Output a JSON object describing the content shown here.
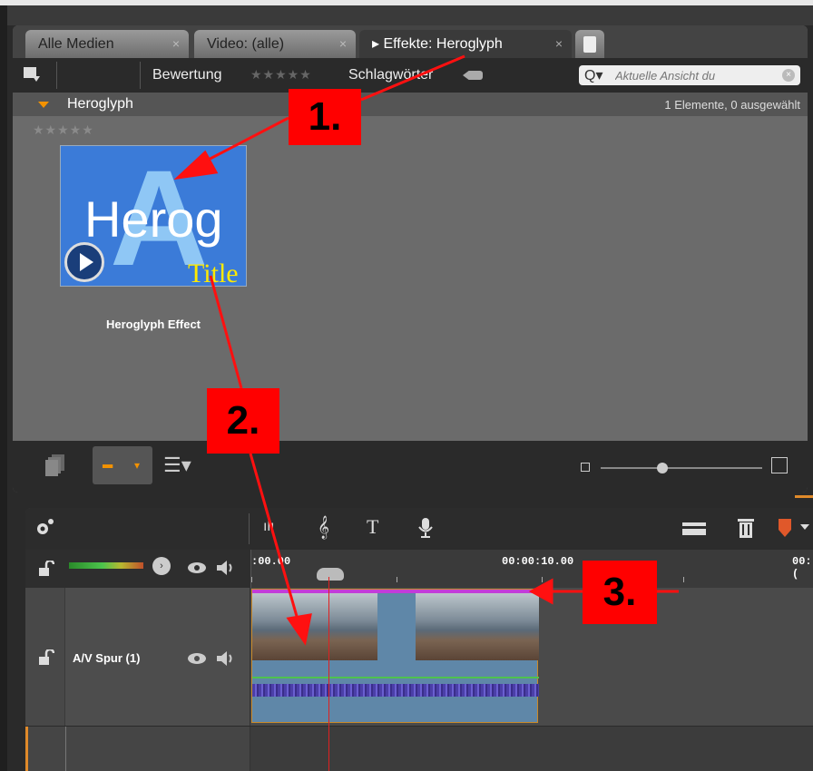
{
  "library": {
    "tabs": [
      {
        "label": "Alle Medien",
        "close": "×"
      },
      {
        "label": "Video: (alle)",
        "close": "×"
      },
      {
        "label": "▸ Effekte: Heroglyph",
        "close": "×"
      }
    ],
    "toolbar": {
      "rating_label": "Bewertung",
      "rating_stars": "★★★★★",
      "keywords_label": "Schlagwörter",
      "search_icon": "Q▾",
      "search_placeholder": "Aktuelle Ansicht du",
      "search_clear": "×"
    },
    "group": {
      "title": "Heroglyph",
      "count": "1 Elemente, 0 ausgewählt"
    },
    "item": {
      "stars": "★★★★★",
      "thumb_big_letter": "A",
      "thumb_word": "Herog",
      "thumb_sub": "Title",
      "label": "Heroglyph Effect"
    },
    "bottom": {
      "grid_icon": "▪▪▪",
      "dropdown": "▾",
      "list_icon": "☰▾"
    }
  },
  "timeline": {
    "toolbar_buttons": [
      "ılı",
      "𝄞",
      "T",
      "🎙"
    ],
    "ruler": {
      "t0": ":00.00",
      "t10": "00:00:10.00",
      "t20": "00:("
    },
    "track1": {
      "name": "A/V Spur (1)"
    },
    "play_glyph": "›"
  },
  "annotations": {
    "callout1": "1.",
    "callout2": "2.",
    "callout3": "3."
  },
  "colors": {
    "accent": "#f39200",
    "callout": "#ff0000",
    "clip_top": "#c33cd8",
    "playhead": "#e02020"
  }
}
